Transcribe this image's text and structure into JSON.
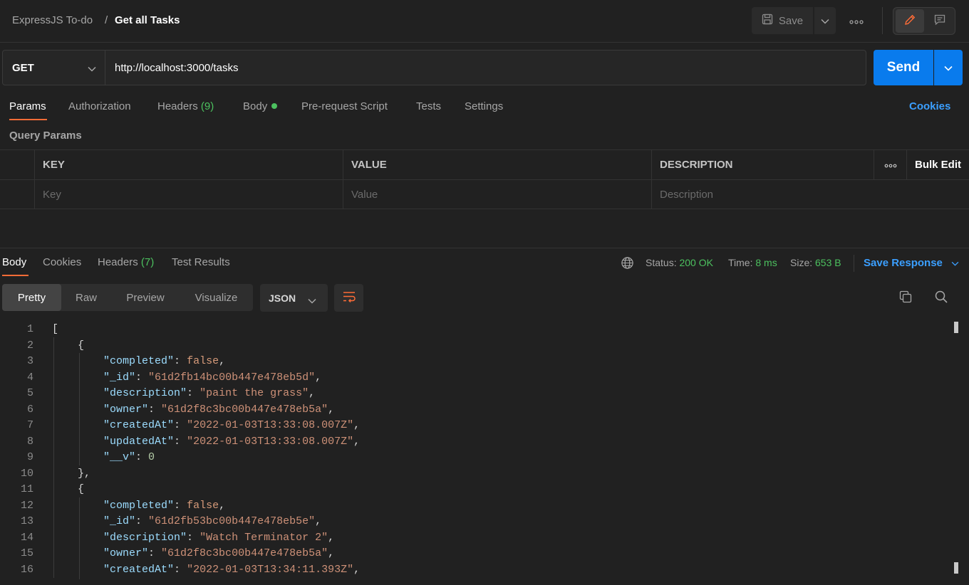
{
  "breadcrumb": {
    "collection": "ExpressJS To-do",
    "separator": "/",
    "request": "Get all Tasks"
  },
  "header": {
    "save_label": "Save"
  },
  "request": {
    "method": "GET",
    "url": "http://localhost:3000/tasks",
    "send_label": "Send"
  },
  "request_tabs": {
    "params": "Params",
    "authorization": "Authorization",
    "headers": "Headers",
    "headers_count": "(9)",
    "body": "Body",
    "prerequest": "Pre-request Script",
    "tests": "Tests",
    "settings": "Settings",
    "cookies": "Cookies"
  },
  "query_params": {
    "title": "Query Params",
    "columns": {
      "key": "KEY",
      "value": "VALUE",
      "description": "DESCRIPTION"
    },
    "bulk_edit": "Bulk Edit",
    "placeholders": {
      "key": "Key",
      "value": "Value",
      "description": "Description"
    }
  },
  "response_tabs": {
    "body": "Body",
    "cookies": "Cookies",
    "headers": "Headers",
    "headers_count": "(7)",
    "test_results": "Test Results"
  },
  "response_meta": {
    "status_label": "Status:",
    "status_value": "200 OK",
    "time_label": "Time:",
    "time_value": "8 ms",
    "size_label": "Size:",
    "size_value": "653 B",
    "save_response": "Save Response"
  },
  "view_tabs": {
    "pretty": "Pretty",
    "raw": "Raw",
    "preview": "Preview",
    "visualize": "Visualize"
  },
  "format": "JSON",
  "code_lines": [
    {
      "n": "1",
      "parts": [
        [
          "p",
          "["
        ]
      ]
    },
    {
      "n": "2",
      "parts": [
        [
          "p",
          "    {"
        ]
      ]
    },
    {
      "n": "3",
      "parts": [
        [
          "p",
          "        "
        ],
        [
          "k",
          "\"completed\""
        ],
        [
          "p",
          ": "
        ],
        [
          "b",
          "false"
        ],
        [
          "p",
          ","
        ]
      ]
    },
    {
      "n": "4",
      "parts": [
        [
          "p",
          "        "
        ],
        [
          "k",
          "\"_id\""
        ],
        [
          "p",
          ": "
        ],
        [
          "s",
          "\"61d2fb14bc00b447e478eb5d\""
        ],
        [
          "p",
          ","
        ]
      ]
    },
    {
      "n": "5",
      "parts": [
        [
          "p",
          "        "
        ],
        [
          "k",
          "\"description\""
        ],
        [
          "p",
          ": "
        ],
        [
          "s",
          "\"paint the grass\""
        ],
        [
          "p",
          ","
        ]
      ]
    },
    {
      "n": "6",
      "parts": [
        [
          "p",
          "        "
        ],
        [
          "k",
          "\"owner\""
        ],
        [
          "p",
          ": "
        ],
        [
          "s",
          "\"61d2f8c3bc00b447e478eb5a\""
        ],
        [
          "p",
          ","
        ]
      ]
    },
    {
      "n": "7",
      "parts": [
        [
          "p",
          "        "
        ],
        [
          "k",
          "\"createdAt\""
        ],
        [
          "p",
          ": "
        ],
        [
          "s",
          "\"2022-01-03T13:33:08.007Z\""
        ],
        [
          "p",
          ","
        ]
      ]
    },
    {
      "n": "8",
      "parts": [
        [
          "p",
          "        "
        ],
        [
          "k",
          "\"updatedAt\""
        ],
        [
          "p",
          ": "
        ],
        [
          "s",
          "\"2022-01-03T13:33:08.007Z\""
        ],
        [
          "p",
          ","
        ]
      ]
    },
    {
      "n": "9",
      "parts": [
        [
          "p",
          "        "
        ],
        [
          "k",
          "\"__v\""
        ],
        [
          "p",
          ": "
        ],
        [
          "n",
          "0"
        ]
      ]
    },
    {
      "n": "10",
      "parts": [
        [
          "p",
          "    },"
        ]
      ]
    },
    {
      "n": "11",
      "parts": [
        [
          "p",
          "    {"
        ]
      ]
    },
    {
      "n": "12",
      "parts": [
        [
          "p",
          "        "
        ],
        [
          "k",
          "\"completed\""
        ],
        [
          "p",
          ": "
        ],
        [
          "b",
          "false"
        ],
        [
          "p",
          ","
        ]
      ]
    },
    {
      "n": "13",
      "parts": [
        [
          "p",
          "        "
        ],
        [
          "k",
          "\"_id\""
        ],
        [
          "p",
          ": "
        ],
        [
          "s",
          "\"61d2fb53bc00b447e478eb5e\""
        ],
        [
          "p",
          ","
        ]
      ]
    },
    {
      "n": "14",
      "parts": [
        [
          "p",
          "        "
        ],
        [
          "k",
          "\"description\""
        ],
        [
          "p",
          ": "
        ],
        [
          "s",
          "\"Watch Terminator 2\""
        ],
        [
          "p",
          ","
        ]
      ]
    },
    {
      "n": "15",
      "parts": [
        [
          "p",
          "        "
        ],
        [
          "k",
          "\"owner\""
        ],
        [
          "p",
          ": "
        ],
        [
          "s",
          "\"61d2f8c3bc00b447e478eb5a\""
        ],
        [
          "p",
          ","
        ]
      ]
    },
    {
      "n": "16",
      "parts": [
        [
          "p",
          "        "
        ],
        [
          "k",
          "\"createdAt\""
        ],
        [
          "p",
          ": "
        ],
        [
          "s",
          "\"2022-01-03T13:34:11.393Z\""
        ],
        [
          "p",
          ","
        ]
      ]
    }
  ],
  "colors": {
    "accent": "#ff6c37",
    "send": "#097bed",
    "link": "#3b9fff",
    "success": "#4cc15f"
  }
}
